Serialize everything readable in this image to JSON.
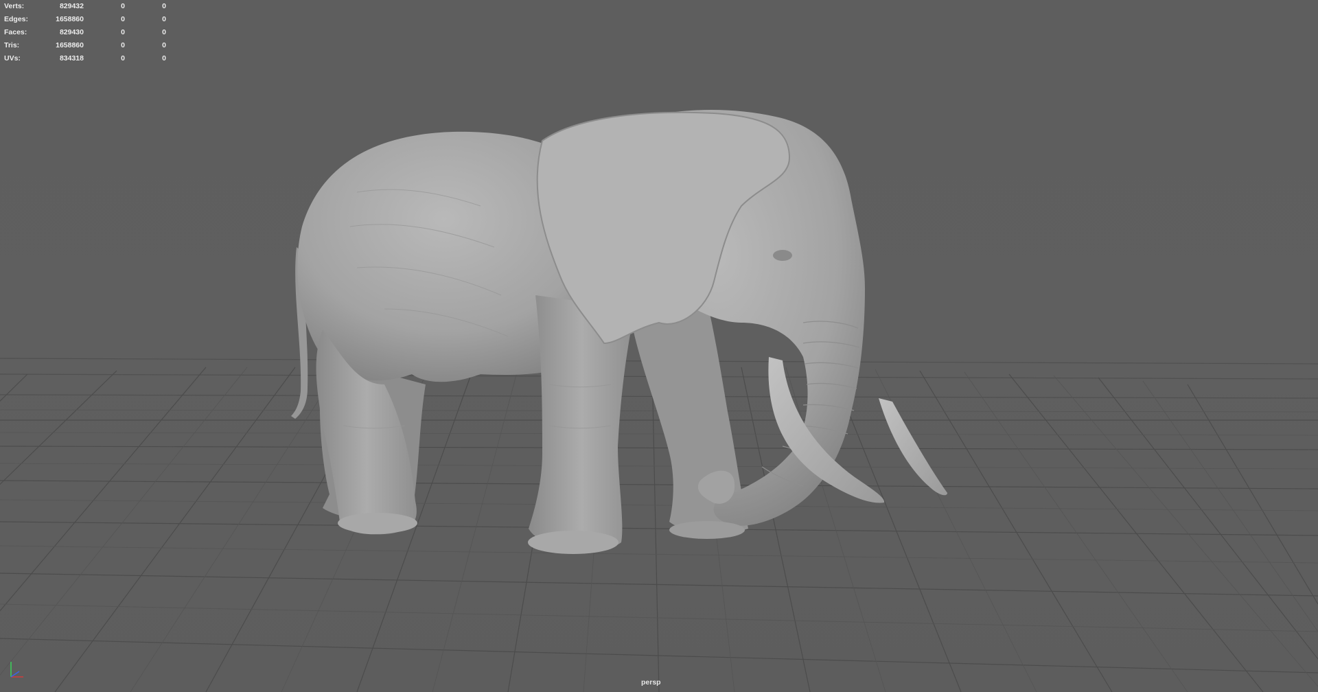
{
  "hud": {
    "rows": [
      {
        "label": "Verts:",
        "value": "829432",
        "sel": "0",
        "comp": "0"
      },
      {
        "label": "Edges:",
        "value": "1658860",
        "sel": "0",
        "comp": "0"
      },
      {
        "label": "Faces:",
        "value": "829430",
        "sel": "0",
        "comp": "0"
      },
      {
        "label": "Tris:",
        "value": "1658860",
        "sel": "0",
        "comp": "0"
      },
      {
        "label": "UVs:",
        "value": "834318",
        "sel": "0",
        "comp": "0"
      }
    ]
  },
  "viewport": {
    "camera": "persp",
    "model": "elephant-sculpt",
    "colors": {
      "background": "#5f5f5f",
      "grid": "#4a4a4a",
      "model": "#a9a9a9"
    }
  },
  "gizmo": {
    "axes": [
      "x",
      "y",
      "z"
    ],
    "colors": {
      "x": "#d23c3c",
      "y": "#3ccc5a",
      "z": "#3c64e6"
    }
  }
}
